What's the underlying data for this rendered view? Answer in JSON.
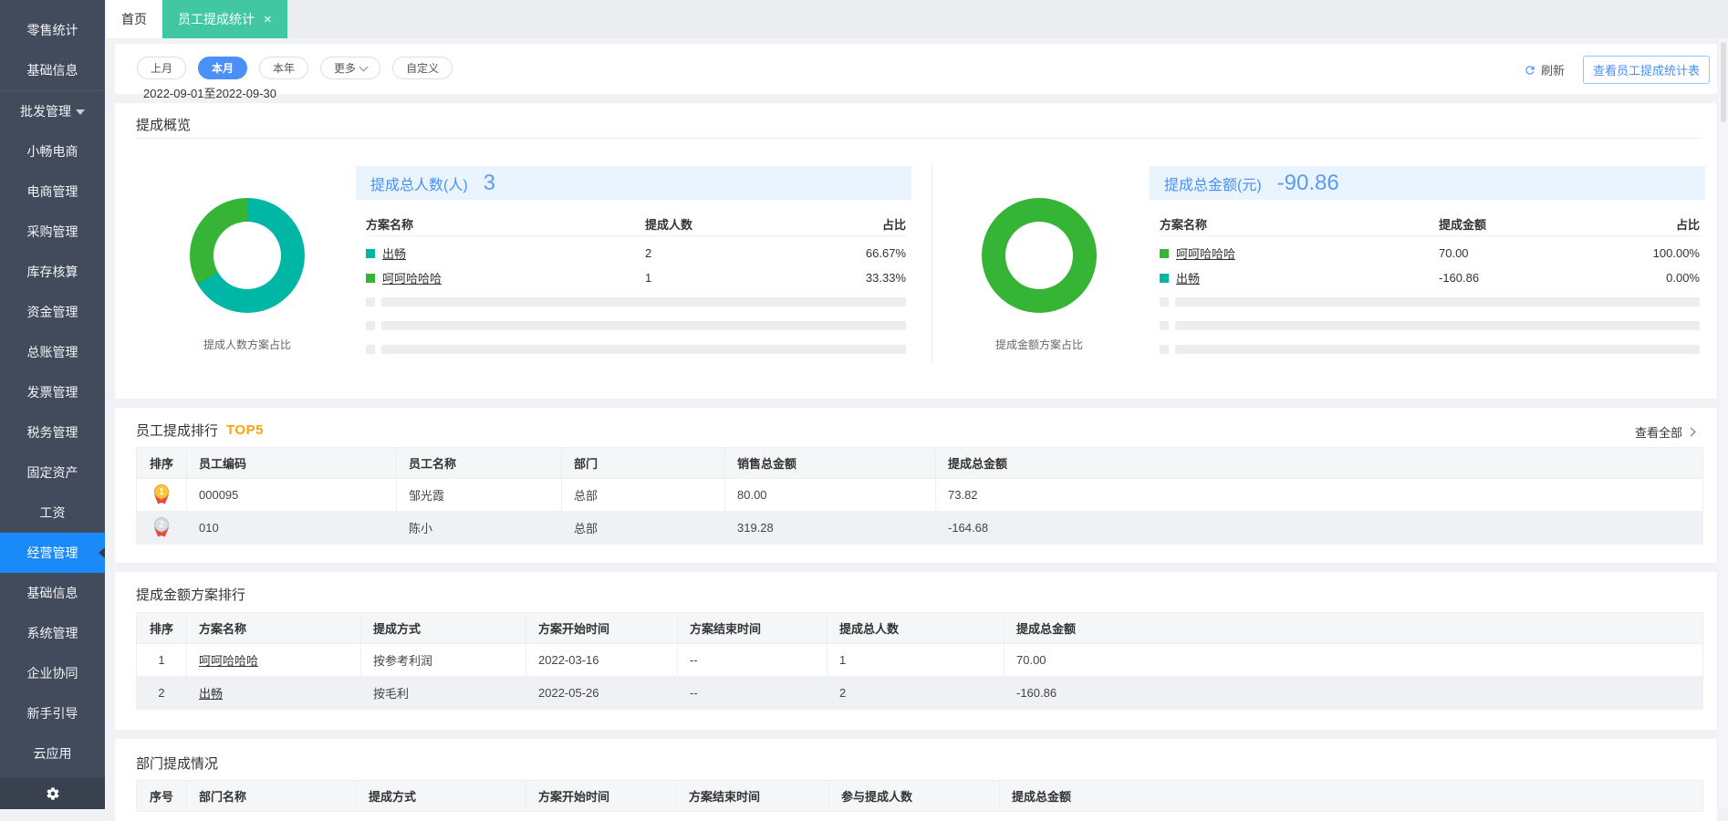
{
  "sidebar": {
    "items": [
      {
        "label": "零售统计"
      },
      {
        "label": "基础信息"
      },
      {
        "label": "批发管理",
        "has_arrow": true
      },
      {
        "label": "小畅电商"
      },
      {
        "label": "电商管理"
      },
      {
        "label": "采购管理"
      },
      {
        "label": "库存核算"
      },
      {
        "label": "资金管理"
      },
      {
        "label": "总账管理"
      },
      {
        "label": "发票管理"
      },
      {
        "label": "税务管理"
      },
      {
        "label": "固定资产"
      },
      {
        "label": "工资"
      },
      {
        "label": "经营管理",
        "active": true
      },
      {
        "label": "基础信息"
      },
      {
        "label": "系统管理"
      },
      {
        "label": "企业协同"
      },
      {
        "label": "新手引导"
      },
      {
        "label": "云应用"
      }
    ]
  },
  "tabs": {
    "items": [
      {
        "label": "首页",
        "active": false,
        "closable": false
      },
      {
        "label": "员工提成统计",
        "active": true,
        "closable": true
      }
    ],
    "close_icon": "×"
  },
  "filter": {
    "pills": [
      {
        "label": "上月"
      },
      {
        "label": "本月",
        "active": true
      },
      {
        "label": "本年"
      },
      {
        "label": "更多",
        "has_caret": true
      },
      {
        "label": "自定义"
      }
    ],
    "date_range": "2022-09-01至2022-09-30",
    "refresh_label": "刷新",
    "view_button": "查看员工提成统计表"
  },
  "overview": {
    "title": "提成概览",
    "left_panel": {
      "stat_label": "提成总人数(人)",
      "stat_value": "3",
      "donut_label": "提成人数方案占比",
      "donut_segments": [
        {
          "name": "出畅",
          "color": "#00b7a6",
          "percent": 66.67
        },
        {
          "name": "呵呵哈哈哈",
          "color": "#35b435",
          "percent": 33.33
        }
      ],
      "table": {
        "headers": [
          "方案名称",
          "提成人数",
          "占比"
        ],
        "rows": [
          {
            "color": "#00b7a6",
            "name": "出畅",
            "value": "2",
            "percent": "66.67%"
          },
          {
            "color": "#35b435",
            "name": "呵呵哈哈哈",
            "value": "1",
            "percent": "33.33%"
          }
        ],
        "skeleton_rows": 3
      }
    },
    "right_panel": {
      "stat_label": "提成总金额(元)",
      "stat_value": "-90.86",
      "donut_label": "提成金额方案占比",
      "donut_segments": [
        {
          "name": "呵呵哈哈哈",
          "color": "#35b435",
          "percent": 100
        },
        {
          "name": "出畅",
          "color": "#00b7a6",
          "percent": 0
        }
      ],
      "table": {
        "headers": [
          "方案名称",
          "提成金额",
          "占比"
        ],
        "rows": [
          {
            "color": "#35b435",
            "name": "呵呵哈哈哈",
            "value": "70.00",
            "percent": "100.00%"
          },
          {
            "color": "#00b7a6",
            "name": "出畅",
            "value": "-160.86",
            "percent": "0.00%"
          }
        ],
        "skeleton_rows": 3
      }
    }
  },
  "employee_ranking": {
    "title": "员工提成排行",
    "badge": "TOP5",
    "view_all": "查看全部",
    "headers": [
      "排序",
      "员工编码",
      "员工名称",
      "部门",
      "销售总金额",
      "提成总金额"
    ],
    "rows": [
      {
        "rank": "1",
        "medal": "gold",
        "cells": [
          "000095",
          "邹光霞",
          "总部",
          "80.00",
          "73.82"
        ]
      },
      {
        "rank": "2",
        "medal": "silver",
        "cells": [
          "010",
          "陈小",
          "总部",
          "319.28",
          "-164.68"
        ]
      }
    ]
  },
  "plan_ranking": {
    "title": "提成金额方案排行",
    "headers": [
      "排序",
      "方案名称",
      "提成方式",
      "方案开始时间",
      "方案结束时间",
      "提成总人数",
      "提成总金额"
    ],
    "rows": [
      {
        "rank": "1",
        "cells": [
          {
            "text": "呵呵哈哈哈",
            "link": true
          },
          "按参考利润",
          "2022-03-16",
          "--",
          "1",
          "70.00"
        ]
      },
      {
        "rank": "2",
        "cells": [
          {
            "text": "出畅",
            "link": true
          },
          "按毛利",
          "2022-05-26",
          "--",
          "2",
          "-160.86"
        ]
      }
    ]
  },
  "department": {
    "title": "部门提成情况",
    "headers": [
      "序号",
      "部门名称",
      "提成方式",
      "方案开始时间",
      "方案结束时间",
      "参与提成人数",
      "提成总金额"
    ],
    "rows": []
  },
  "colors": {
    "accent_blue": "#4a90f8",
    "sidebar_active_blue": "#1a89fa",
    "tab_green": "#41c8a3",
    "teal": "#00b7a6",
    "green": "#35b435",
    "orange": "#ffa408",
    "banner_bg": "#e9f4fe"
  }
}
